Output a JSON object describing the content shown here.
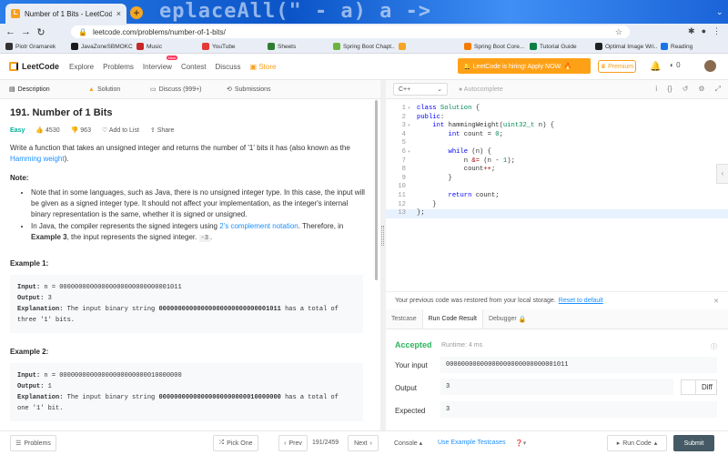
{
  "browser": {
    "tab_title": "Number of 1 Bits - LeetCode",
    "tab_close": "×",
    "new_tab": "+",
    "watermark": "eplaceAll(\" -    a)  a  ->",
    "url": "leetcode.com/problems/number-of-1-bits/",
    "bookmarks": [
      {
        "label": "Piotr Gramarek",
        "color": "#333333"
      },
      {
        "label": "JavaZoneSBMOKCL",
        "color": "#1b1b1b"
      },
      {
        "label": "Music",
        "color": "#c62828"
      },
      {
        "label": "YouTube",
        "color": "#e53935"
      },
      {
        "label": "Sheets",
        "color": "#2e7d32"
      },
      {
        "label": "Spring Boot Chapt...",
        "color": "#6db33f"
      },
      {
        "label": "",
        "color": "#f5a623"
      },
      {
        "label": "Spring Boot Core...",
        "color": "#f57c00"
      },
      {
        "label": "Tutorial Guide",
        "color": "#0b8043"
      },
      {
        "label": "Optimal Image Wri...",
        "color": "#202124"
      },
      {
        "label": "Reading",
        "color": "#1a73e8"
      }
    ]
  },
  "header": {
    "logo": "LeetCode",
    "nav": [
      "Explore",
      "Problems",
      "Interview",
      "Contest",
      "Discuss"
    ],
    "new_badge": "New",
    "store": "Store",
    "promo": "🔔 LeetCode is hiring! Apply NOW. 🔥",
    "premium": "Premium",
    "notif_count": "0"
  },
  "left_tabs": [
    "Description",
    "Solution",
    "Discuss (999+)",
    "Submissions"
  ],
  "problem": {
    "title": "191. Number of 1 Bits",
    "difficulty": "Easy",
    "likes": "4530",
    "dislikes": "963",
    "add_to_list": "Add to List",
    "share": "Share",
    "intro": "Write a function that takes an unsigned integer and returns the number of '1' bits it has (also known as the",
    "hamming": "Hamming weight",
    "intro_end": ").",
    "note_heading": "Note:",
    "note1": "Note that in some languages, such as Java, there is no unsigned integer type. In this case, the input will be given as a signed integer type. It should not affect your implementation, as the integer's internal binary representation is the same, whether it is signed or unsigned.",
    "note2_a": "In Java, the compiler represents the signed integers using",
    "note2_link": "2's complement notation",
    "note2_b": ". Therefore, in",
    "note2_bold": "Example 3",
    "note2_c": ", the input represents the signed integer.",
    "note2_code": "-3",
    "note2_end": ".",
    "examples": [
      {
        "heading": "Example 1:",
        "input_label": "Input:",
        "input": " n = 00000000000000000000000000001011",
        "output_label": "Output:",
        "output": " 3",
        "expl_label": "Explanation:",
        "expl_a": " The input binary string ",
        "expl_bold": "00000000000000000000000000001011",
        "expl_b": " has a total of",
        "expl_c": "three '1' bits."
      },
      {
        "heading": "Example 2:",
        "input_label": "Input:",
        "input": " n = 00000000000000000000000010000000",
        "output_label": "Output:",
        "output": " 1",
        "expl_label": "Explanation:",
        "expl_a": " The input binary string ",
        "expl_bold": "00000000000000000000000010000000",
        "expl_b": " has a total of",
        "expl_c": "one '1' bit."
      }
    ]
  },
  "editor": {
    "language": "C++",
    "autocomplete": "Autocomplete",
    "line_numbers": [
      "1",
      "2",
      "3",
      "4",
      "5",
      "6",
      "7",
      "8",
      "9",
      "10",
      "11",
      "12",
      "13"
    ]
  },
  "restore": {
    "text": "Your previous code was restored from your local storage.",
    "link": "Reset to default"
  },
  "result_tabs": [
    "Testcase",
    "Run Code Result",
    "Debugger"
  ],
  "result": {
    "status": "Accepted",
    "runtime": "Runtime: 4 ms",
    "input_label": "Your input",
    "input": "00000000000000000000000000001011",
    "output_label": "Output",
    "output": "3",
    "expected_label": "Expected",
    "expected": "3",
    "diff": "Diff"
  },
  "bottom": {
    "problems": "Problems",
    "pick_one": "Pick One",
    "prev": "Prev",
    "page": "191/2459",
    "next": "Next",
    "console": "Console",
    "use_example": "Use Example Testcases",
    "run_code": "Run Code",
    "submit": "Submit"
  }
}
